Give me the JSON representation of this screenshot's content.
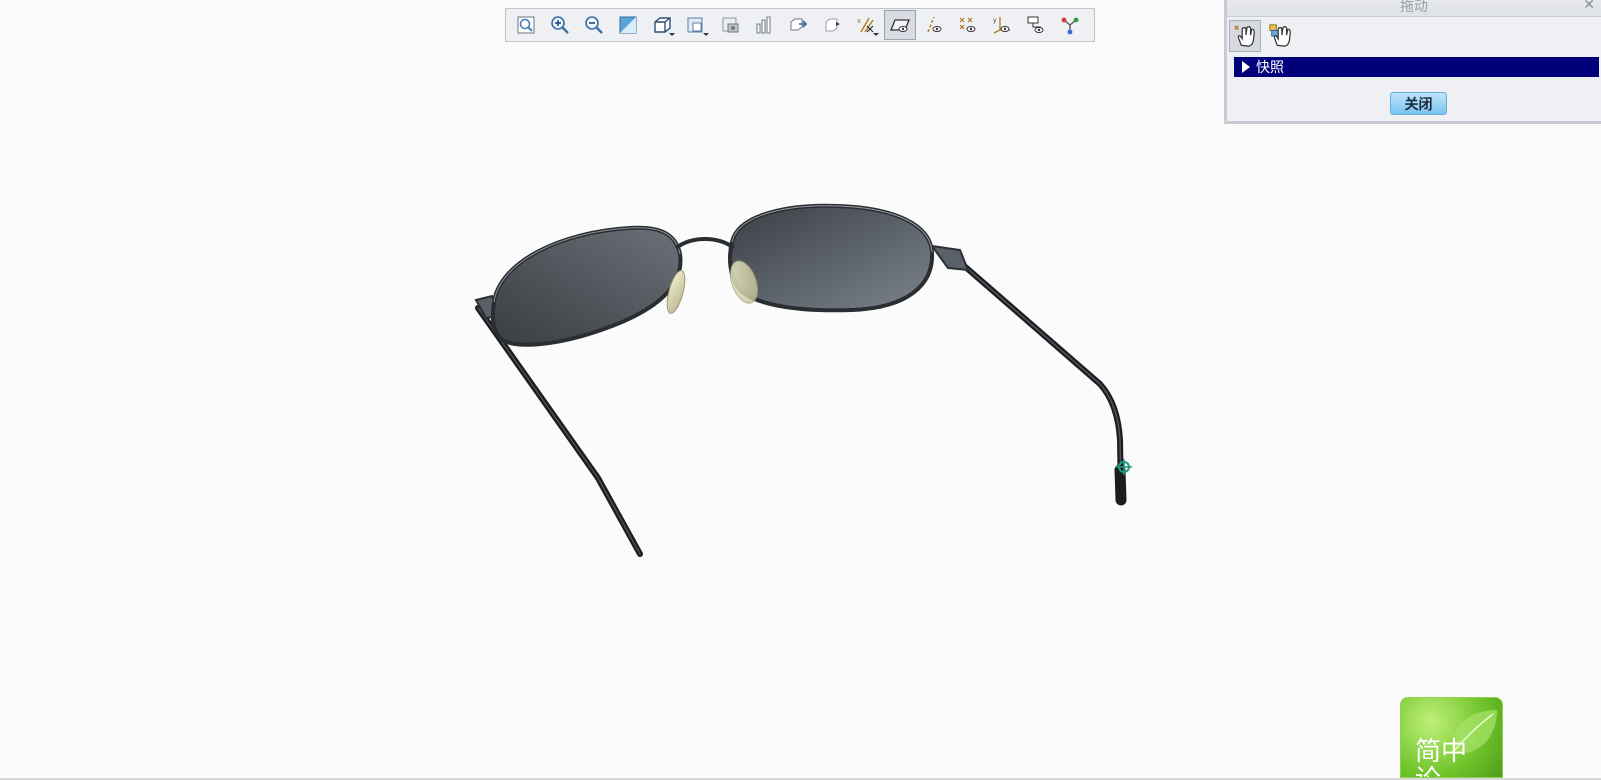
{
  "toolbar": {
    "buttons": [
      {
        "icon": "refit-icon"
      },
      {
        "icon": "zoom-in-icon"
      },
      {
        "icon": "zoom-out-icon"
      },
      {
        "icon": "repaint-icon"
      },
      {
        "icon": "reorient-icon",
        "dropdown": true
      },
      {
        "icon": "saved-views-icon",
        "dropdown": true
      },
      {
        "icon": "layers-icon"
      },
      {
        "icon": "display-style-icon"
      },
      {
        "icon": "pan-icon"
      },
      {
        "icon": "spin-center-icon"
      },
      {
        "icon": "datum-display-icon",
        "dropdown": true
      },
      {
        "icon": "plane-display-icon",
        "active": true
      },
      {
        "icon": "axis-display-icon"
      },
      {
        "icon": "point-display-icon"
      },
      {
        "icon": "csys-display-icon"
      },
      {
        "icon": "annotation-display-icon"
      },
      {
        "icon": "connect-icon"
      }
    ]
  },
  "drag_panel": {
    "title": "拖动",
    "close_glyph": "✕",
    "tools": [
      {
        "icon": "point-drag-hand-icon",
        "active": true
      },
      {
        "icon": "body-drag-hand-icon",
        "active": false
      }
    ],
    "snapshot_label": "快照",
    "close_button_label": "关闭"
  },
  "badge": {
    "text": "简中论"
  },
  "colors": {
    "selection_row": "#00007b",
    "close_button": "#79c3ef",
    "badge_green": "#6fc42a"
  }
}
